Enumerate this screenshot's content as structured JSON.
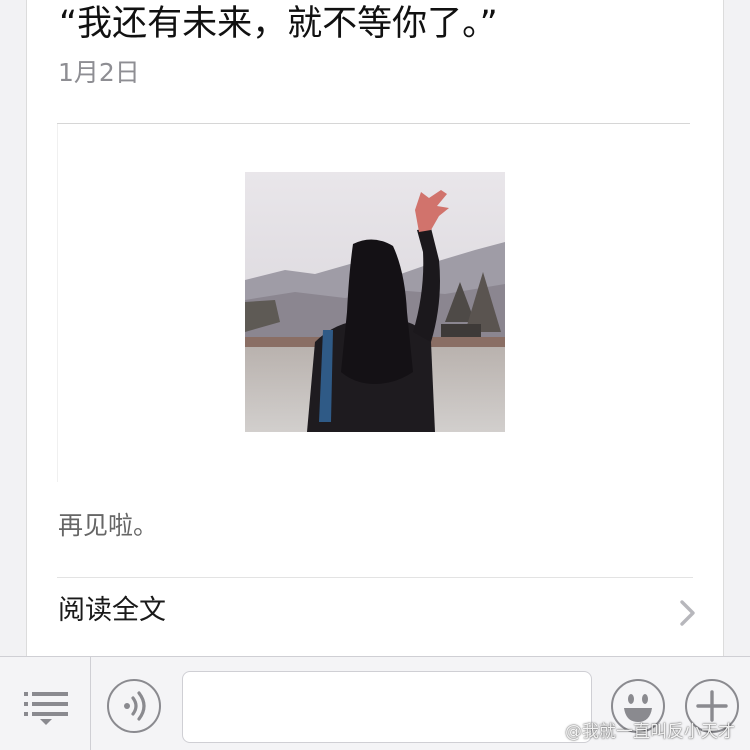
{
  "article": {
    "title": "“我还有未来，就不等你了。”",
    "date": "1月2日",
    "excerpt": "再见啦。",
    "read_more_label": "阅读全文"
  },
  "media": {
    "photo_subject": "girl-waving-at-mountains"
  },
  "toolbar": {
    "input_value": "",
    "icons": {
      "menu": "list-menu-icon",
      "voice": "voice-icon",
      "emoji": "smiley-icon",
      "more": "plus-icon"
    }
  },
  "watermark": {
    "text": "@我就一直叫反小天才"
  },
  "colors": {
    "background": "#f2f2f4",
    "card": "#ffffff",
    "title": "#111111",
    "secondary_text": "#8e8e93",
    "icon_gray": "#8a8a8f"
  }
}
